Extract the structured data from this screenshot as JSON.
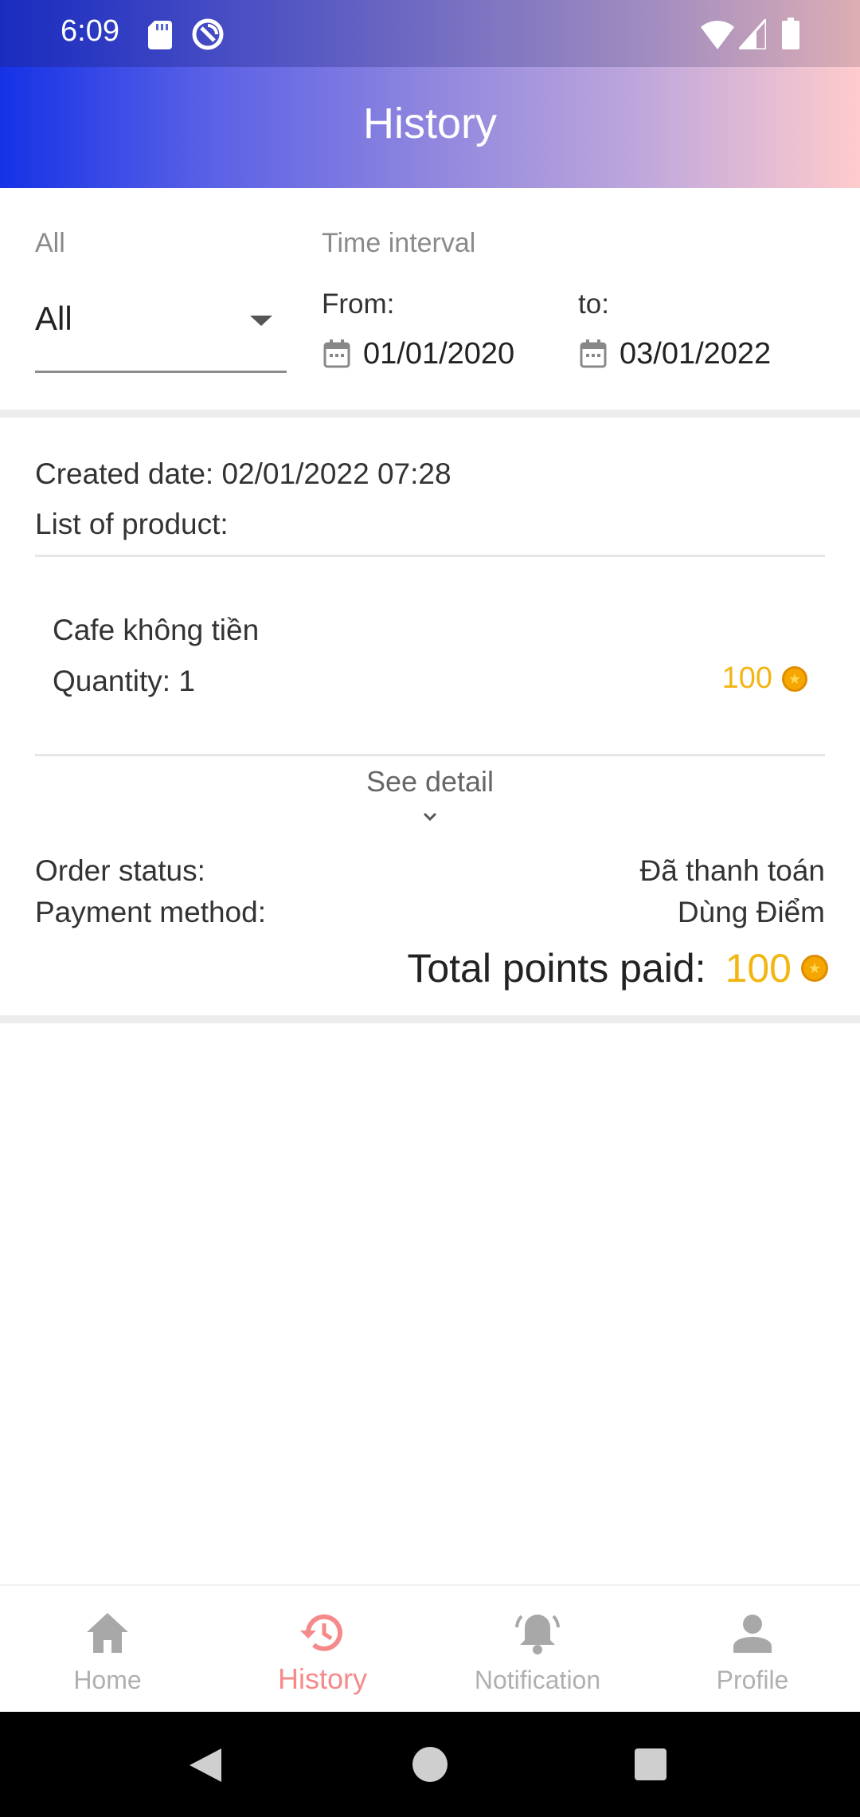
{
  "status_bar": {
    "time": "6:09"
  },
  "header": {
    "title": "History"
  },
  "filter": {
    "category_label": "All",
    "category_value": "All",
    "time_interval_label": "Time interval",
    "from_label": "From:",
    "to_label": "to:",
    "from_date": "01/01/2020",
    "to_date": "03/01/2022"
  },
  "order": {
    "created_date": "Created date: 02/01/2022 07:28",
    "list_label": "List of product:",
    "products": [
      {
        "name": "Cafe không tiền",
        "quantity": "Quantity: 1",
        "points": "100"
      }
    ],
    "see_detail": "See detail",
    "status_label": "Order status:",
    "status_value": "Đã thanh toán",
    "payment_label": "Payment method:",
    "payment_value": "Dùng Điểm",
    "total_label": "Total points paid:",
    "total_value": "100"
  },
  "colors": {
    "points": "#f2b512",
    "active_tab": "#f58a8a",
    "inactive_tab": "#b0b0b0"
  },
  "bottom_nav": {
    "items": [
      {
        "label": "Home",
        "icon": "home-icon",
        "active": false
      },
      {
        "label": "History",
        "icon": "history-icon",
        "active": true
      },
      {
        "label": "Notification",
        "icon": "bell-icon",
        "active": false
      },
      {
        "label": "Profile",
        "icon": "person-icon",
        "active": false
      }
    ]
  }
}
